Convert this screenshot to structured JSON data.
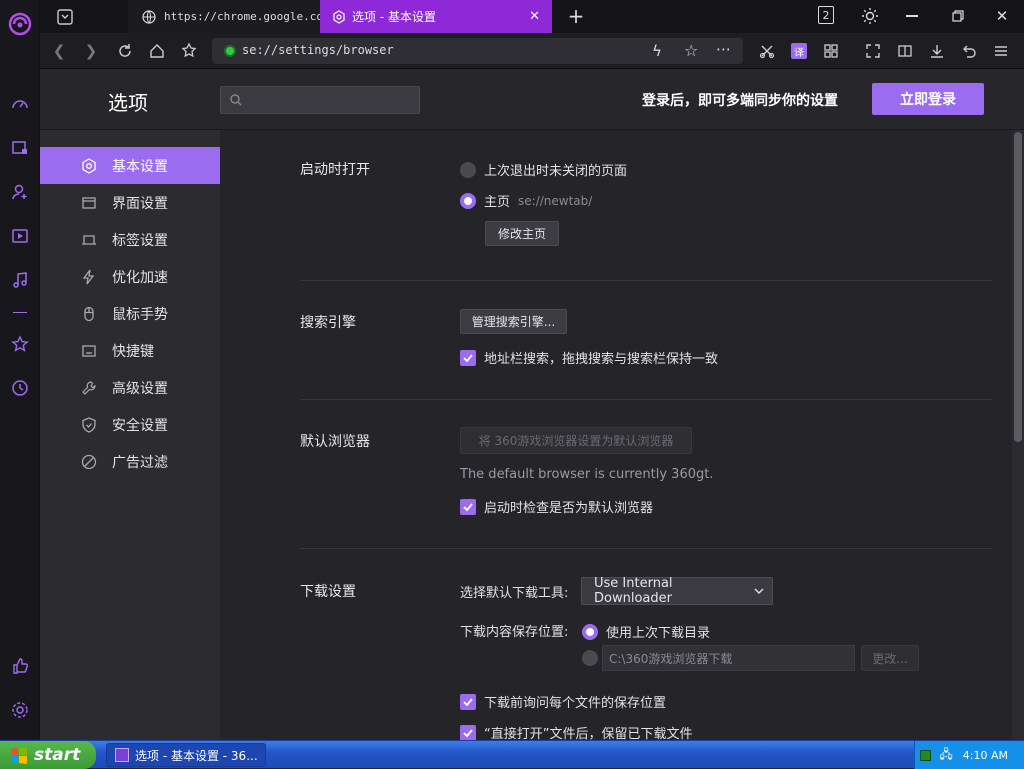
{
  "browser": {
    "tabs": [
      {
        "label": "https://chrome.google.com/web",
        "icon": "globe-icon"
      },
      {
        "label": "选项 - 基本设置",
        "icon": "gear-icon",
        "active": true
      }
    ],
    "new_tab_label": "+",
    "tab_count": "2",
    "address": "se://settings/browser",
    "accent": "#8e29d8"
  },
  "settings": {
    "page_title": "选项",
    "search_placeholder": "",
    "sync_text": "登录后，即可多端同步你的设置",
    "login_button": "立即登录",
    "sidebar": [
      {
        "label": "基本设置",
        "icon": "gear-icon",
        "active": true
      },
      {
        "label": "界面设置",
        "icon": "window-icon"
      },
      {
        "label": "标签设置",
        "icon": "tab-icon"
      },
      {
        "label": "优化加速",
        "icon": "lightning-icon"
      },
      {
        "label": "鼠标手势",
        "icon": "mouse-icon"
      },
      {
        "label": "快捷键",
        "icon": "keyboard-icon"
      },
      {
        "label": "高级设置",
        "icon": "wrench-icon"
      },
      {
        "label": "安全设置",
        "icon": "shield-icon"
      },
      {
        "label": "广告过滤",
        "icon": "block-icon"
      }
    ],
    "startup": {
      "title": "启动时打开",
      "option1": "上次退出时未关闭的页面",
      "option2": "主页",
      "homepage": "se://newtab/",
      "modify_button": "修改主页"
    },
    "search": {
      "title": "搜索引擎",
      "manage_button": "管理搜索引擎...",
      "sync_checkbox": "地址栏搜索，拖拽搜索与搜索栏保持一致"
    },
    "default_browser": {
      "title": "默认浏览器",
      "set_button": "将 360游戏浏览器设置为默认浏览器",
      "status": "The default browser is currently 360gt.",
      "check_checkbox": "启动时检查是否为默认浏览器"
    },
    "download": {
      "title": "下载设置",
      "tool_label": "选择默认下载工具:",
      "tool_value": "Use Internal Downloader",
      "location_label": "下载内容保存位置:",
      "option_last": "使用上次下载目录",
      "path_value": "C:\\360游戏浏览器下载",
      "change_button": "更改...",
      "ask_checkbox": "下载前询问每个文件的保存位置",
      "keep_checkbox": "“直接打开”文件后，保留已下载文件"
    }
  },
  "taskbar": {
    "start_label": "start",
    "window_title": "选项 - 基本设置 - 36...",
    "clock": "4:10 AM"
  }
}
